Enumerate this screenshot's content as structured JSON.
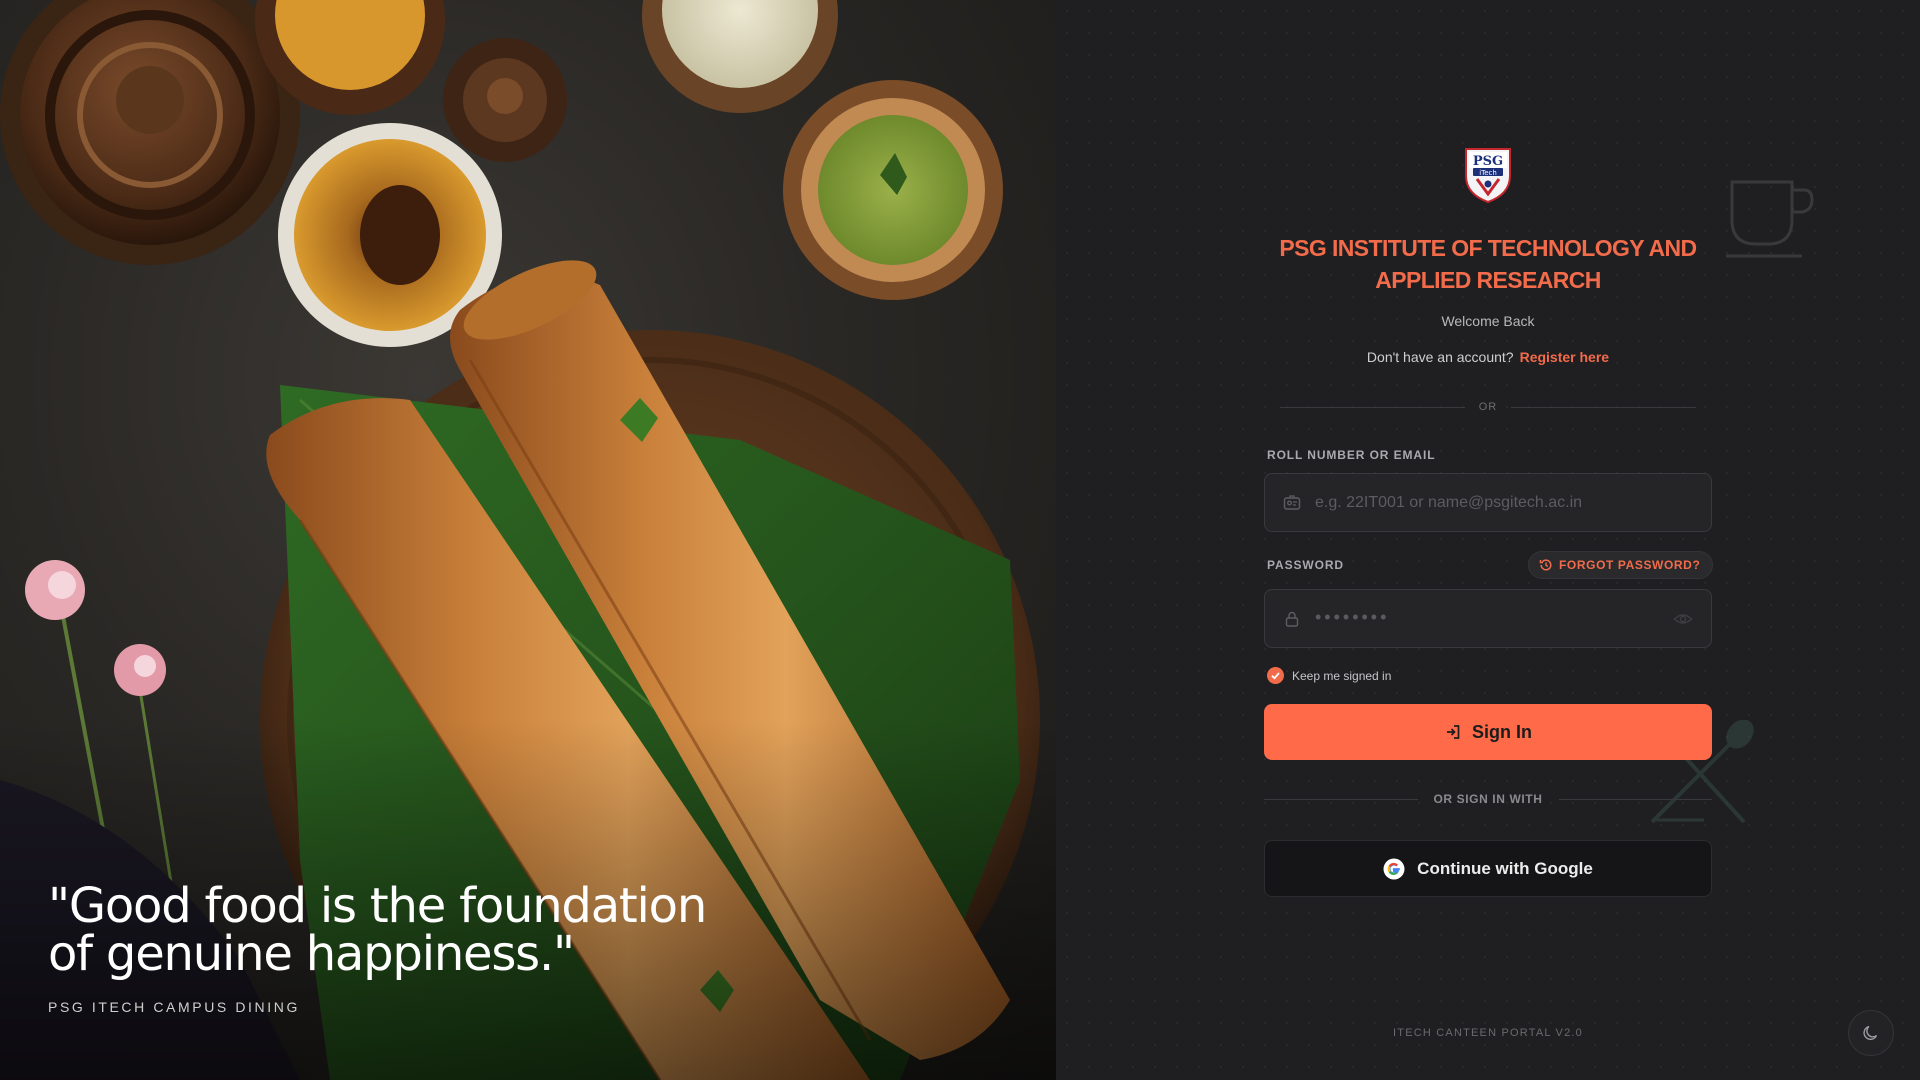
{
  "hero": {
    "quote_line1": "\"Good food is the foundation",
    "quote_line2": "of genuine happiness.\"",
    "caption": "PSG ITECH CAMPUS DINING"
  },
  "logo": {
    "line1": "PSG",
    "line2": "iTech"
  },
  "header": {
    "title_line1": "PSG INSTITUTE OF TECHNOLOGY AND",
    "title_line2": "APPLIED RESEARCH",
    "welcome": "Welcome Back",
    "no_account": "Don't have an account?",
    "register_link": "Register here",
    "or": "OR"
  },
  "form": {
    "identifier_label": "ROLL NUMBER OR EMAIL",
    "identifier_placeholder": "e.g. 22IT001 or name@psgitech.ac.in",
    "password_label": "PASSWORD",
    "password_placeholder": "••••••••",
    "forgot_password": "FORGOT PASSWORD?",
    "remember_me": "Keep me signed in",
    "remember_checked": true,
    "signin_label": "Sign In",
    "signin_with": "OR SIGN IN WITH",
    "google_label": "Continue with Google"
  },
  "footer": {
    "version": "ITECH CANTEEN PORTAL V2.0"
  },
  "colors": {
    "accent": "#ff6a48",
    "title": "#f26b4a",
    "background": "#1f1f21"
  },
  "icons": [
    "id-card-icon",
    "lock-icon",
    "eye-icon",
    "history-icon",
    "check-icon",
    "login-icon",
    "google-icon",
    "moon-icon",
    "coffee-cup-icon",
    "utensils-icon"
  ]
}
